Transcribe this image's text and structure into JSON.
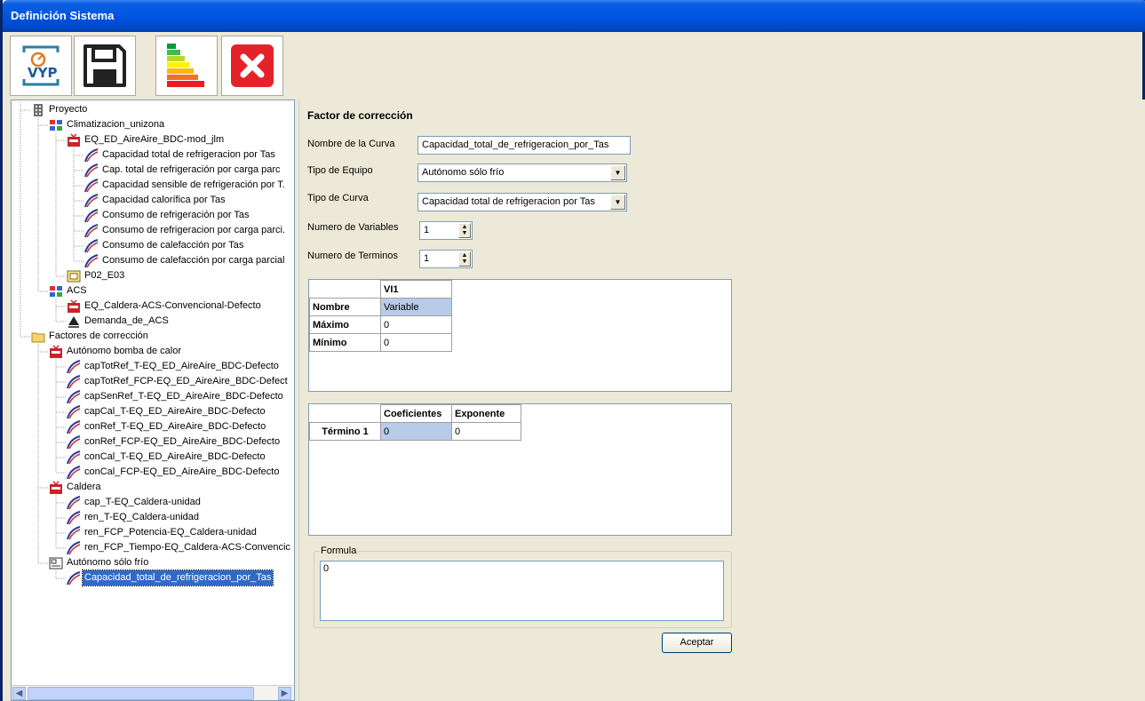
{
  "window": {
    "title": "Definición Sistema"
  },
  "toolbar": {
    "buttons": [
      {
        "name": "vyp-logo-button",
        "label": "VYP",
        "icon": "vyp-logo-icon"
      },
      {
        "name": "save-button",
        "icon": "floppy-disk-icon"
      },
      {
        "name": "energy-rating-button",
        "icon": "energy-rating-icon"
      },
      {
        "name": "close-button",
        "icon": "close-icon"
      }
    ]
  },
  "tree": {
    "nodes": [
      {
        "label": "Proyecto",
        "icon": "project-icon",
        "level": 0
      },
      {
        "label": "Climatizacion_unizona",
        "icon": "system-icon",
        "level": 1
      },
      {
        "label": "EQ_ED_AireAire_BDC-mod_jlm",
        "icon": "equipment-icon",
        "level": 2
      },
      {
        "label": "Capacidad total de refrigeracion por Tas",
        "icon": "curve-icon",
        "level": 3
      },
      {
        "label": "Cap. total de refrigeración por carga parc",
        "icon": "curve-icon",
        "level": 3
      },
      {
        "label": "Capacidad sensible de refrigeración por T.",
        "icon": "curve-icon",
        "level": 3
      },
      {
        "label": "Capacidad calorífica por Tas",
        "icon": "curve-icon",
        "level": 3
      },
      {
        "label": "Consumo de refrigeración por Tas",
        "icon": "curve-icon",
        "level": 3
      },
      {
        "label": "Consumo de refrigeracion por carga parci.",
        "icon": "curve-icon",
        "level": 3
      },
      {
        "label": "Consumo de calefacción por Tas",
        "icon": "curve-icon",
        "level": 3
      },
      {
        "label": "Consumo de calefacción por carga parcial",
        "icon": "curve-icon",
        "level": 3
      },
      {
        "label": "P02_E03",
        "icon": "zone-icon",
        "level": 2
      },
      {
        "label": "ACS",
        "icon": "system-icon",
        "level": 1
      },
      {
        "label": "EQ_Caldera-ACS-Convencional-Defecto",
        "icon": "equipment-icon",
        "level": 2
      },
      {
        "label": "Demanda_de_ACS",
        "icon": "demand-icon",
        "level": 2
      },
      {
        "label": "Factores de corrección",
        "icon": "folder-icon",
        "level": 0
      },
      {
        "label": "Autónomo bomba de calor",
        "icon": "equipment-icon",
        "level": 1
      },
      {
        "label": "capTotRef_T-EQ_ED_AireAire_BDC-Defecto",
        "icon": "curve-icon",
        "level": 2
      },
      {
        "label": "capTotRef_FCP-EQ_ED_AireAire_BDC-Defect",
        "icon": "curve-icon",
        "level": 2
      },
      {
        "label": "capSenRef_T-EQ_ED_AireAire_BDC-Defecto",
        "icon": "curve-icon",
        "level": 2
      },
      {
        "label": "capCal_T-EQ_ED_AireAire_BDC-Defecto",
        "icon": "curve-icon",
        "level": 2
      },
      {
        "label": "conRef_T-EQ_ED_AireAire_BDC-Defecto",
        "icon": "curve-icon",
        "level": 2
      },
      {
        "label": "conRef_FCP-EQ_ED_AireAire_BDC-Defecto",
        "icon": "curve-icon",
        "level": 2
      },
      {
        "label": "conCal_T-EQ_ED_AireAire_BDC-Defecto",
        "icon": "curve-icon",
        "level": 2
      },
      {
        "label": "conCal_FCP-EQ_ED_AireAire_BDC-Defecto",
        "icon": "curve-icon",
        "level": 2
      },
      {
        "label": "Caldera",
        "icon": "equipment-icon",
        "level": 1
      },
      {
        "label": "cap_T-EQ_Caldera-unidad",
        "icon": "curve-icon",
        "level": 2
      },
      {
        "label": "ren_T-EQ_Caldera-unidad",
        "icon": "curve-icon",
        "level": 2
      },
      {
        "label": "ren_FCP_Potencia-EQ_Caldera-unidad",
        "icon": "curve-icon",
        "level": 2
      },
      {
        "label": "ren_FCP_Tiempo-EQ_Caldera-ACS-Convencic",
        "icon": "curve-icon",
        "level": 2
      },
      {
        "label": "Autónomo sólo frío",
        "icon": "group-icon",
        "level": 1
      },
      {
        "label": "Capacidad_total_de_refrigeracion_por_Tas",
        "icon": "curve-icon",
        "level": 2,
        "selected": true
      }
    ]
  },
  "form": {
    "title": "Factor de corrección",
    "curve_name_label": "Nombre de la Curva",
    "curve_name_value": "Capacidad_total_de_refrigeracion_por_Tas",
    "equipment_type_label": "Tipo de Equipo",
    "equipment_type_value": "Autónomo sólo frío",
    "curve_type_label": "Tipo de Curva",
    "curve_type_value": "Capacidad total de refrigeracion por Tas",
    "num_variables_label": "Numero de Variables",
    "num_variables_value": "1",
    "num_terms_label": "Numero de Terminos",
    "num_terms_value": "1"
  },
  "variables_table": {
    "column": "VI1",
    "rows": [
      {
        "header": "Nombre",
        "value": "Variable"
      },
      {
        "header": "Máximo",
        "value": "0"
      },
      {
        "header": "Mínimo",
        "value": "0"
      }
    ]
  },
  "terms_table": {
    "columns": [
      "Coeficientes",
      "Exponente"
    ],
    "rows": [
      {
        "header": "Término  1",
        "coef": "0",
        "exp": "0"
      }
    ]
  },
  "formula": {
    "label": "Formula",
    "value": "0"
  },
  "accept_button": "Aceptar"
}
